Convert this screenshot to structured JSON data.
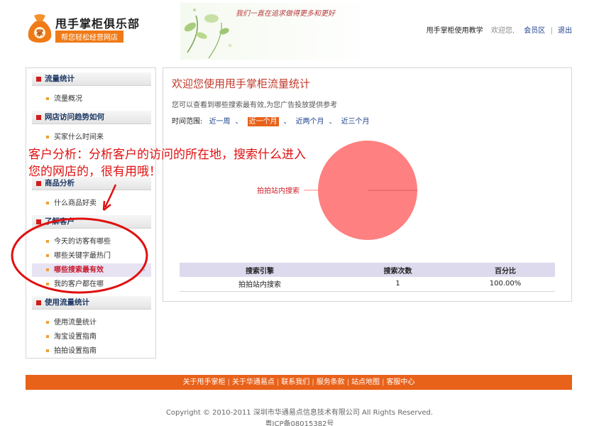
{
  "header": {
    "logo_title": "甩手掌柜俱乐部",
    "logo_slogan": "帮您轻松经营网店",
    "banner_text": "我们一直在追求做得更多和更好",
    "nav_teach": "甩手掌柜使用教学",
    "nav_welcome": "欢迎您,",
    "nav_member": "会员区",
    "nav_logout": "退出"
  },
  "sidebar": {
    "sections": [
      {
        "title": "流量统计",
        "items": [
          "流量概况"
        ]
      },
      {
        "title": "网店访问趋势如何",
        "items": [
          "买家什么时间来"
        ]
      },
      {
        "title": "商品分析",
        "items": [
          "什么商品好卖"
        ]
      },
      {
        "title": "了解客户",
        "items": [
          "今天的访客有哪些",
          "哪些关键字最热门",
          "哪些搜索最有效",
          "我的客户都在哪"
        ]
      },
      {
        "title": "使用流量统计",
        "items": [
          "使用流量统计",
          "淘宝设置指南",
          "拍拍设置指南"
        ]
      }
    ]
  },
  "main": {
    "title": "欢迎您使用甩手掌柜流量统计",
    "desc": "您可以查看到哪些搜索最有效,为您广告投放提供参考",
    "range_label": "时间范围:",
    "ranges": [
      "近一周",
      "近一个月",
      "近两个月",
      "近三个月"
    ],
    "selected_range": "近一个月",
    "table": {
      "headers": [
        "搜索引擎",
        "搜索次数",
        "百分比"
      ],
      "rows": [
        [
          "拍拍站内搜索",
          "1",
          "100.00%"
        ]
      ]
    }
  },
  "chart_data": {
    "type": "pie",
    "labels": [
      "拍拍站内搜索"
    ],
    "values": [
      100
    ],
    "colors": [
      "#ff8080"
    ]
  },
  "annotation": {
    "text": "客户分析：分析客户的访问的所在地，搜索什么进入您的网店的，很有用哦！",
    "color": "#e01010"
  },
  "footer": {
    "links": [
      "关于甩手掌柜",
      "关于华通易点",
      "联系我们",
      "服务条款",
      "站点地图",
      "客服中心"
    ],
    "copyright": "Copyright © 2010-2011 深圳市华通易点信息技术有限公司  All Rights Reserved.",
    "icp": "粤ICP备08015382号"
  },
  "colors": {
    "accent": "#e8621a",
    "title_red": "#c0392b",
    "link_blue": "#1b3f8a",
    "nav_square": "#d21b1b"
  }
}
